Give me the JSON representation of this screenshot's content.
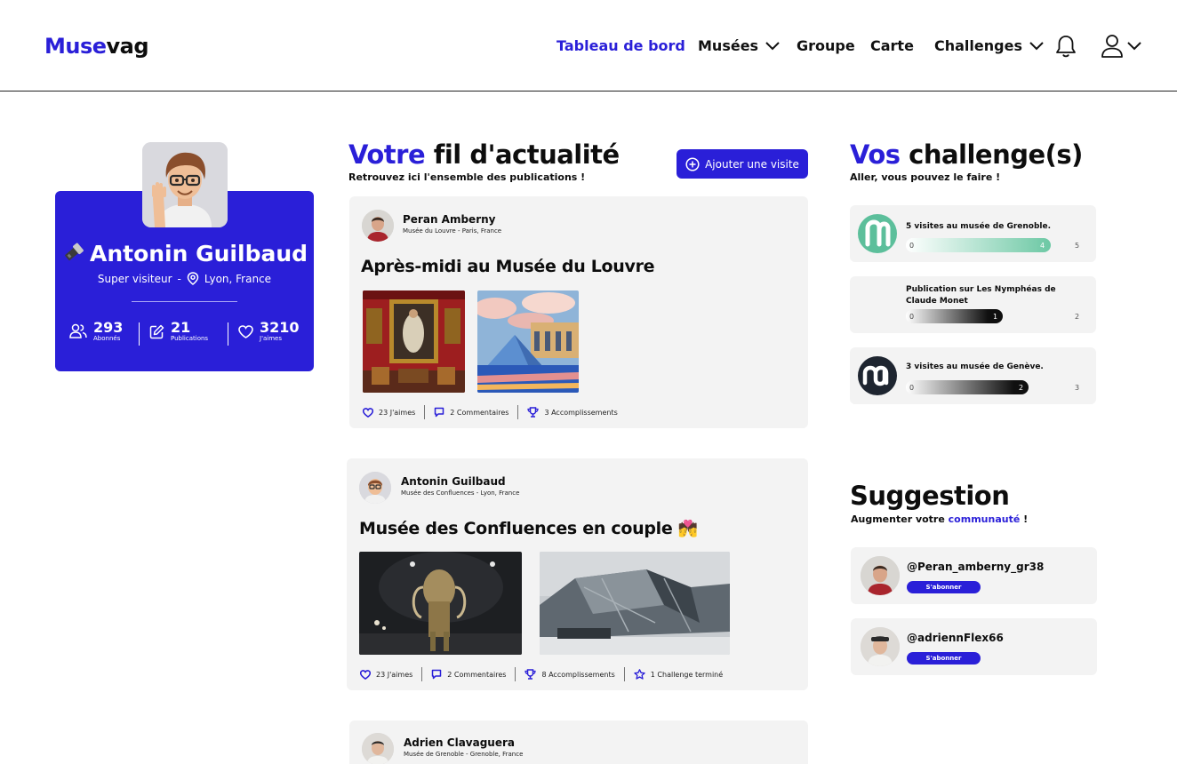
{
  "header": {
    "logo_part1": "Muse",
    "logo_part2": "vag",
    "nav": {
      "dashboard": "Tableau de bord",
      "museums": "Musées",
      "group": "Groupe",
      "map": "Carte",
      "challenges": "Challenges"
    }
  },
  "profile": {
    "name": "Antonin Guilbaud",
    "rank": "Super visiteur",
    "separator": "-",
    "location": "Lyon, France",
    "stats": [
      {
        "value": "293",
        "label": "Abonnés",
        "icon": "users-icon"
      },
      {
        "value": "21",
        "label": "Publications",
        "icon": "edit-icon"
      },
      {
        "value": "3210",
        "label": "J'aimes",
        "icon": "heart-icon"
      }
    ]
  },
  "feed": {
    "title_hl": "Votre",
    "title_rest": " fil d'actualité",
    "subtitle": "Retrouvez ici l'ensemble des publications !",
    "add_button": "Ajouter une visite",
    "posts": [
      {
        "author": "Peran Amberny",
        "place": "Musée du Louvre - Paris, France",
        "title": "Après-midi au Musée du Louvre",
        "likes": "23 J'aimes",
        "comments": "2 Commentaires",
        "achievements": "3 Accomplissements"
      },
      {
        "author": "Antonin Guilbaud",
        "place": "Musée des Confluences - Lyon, France",
        "title": "Musée des Confluences en couple",
        "emoji": "💏",
        "likes": "23 J'aimes",
        "comments": "2 Commentaires",
        "achievements": "8 Accomplissements",
        "challenge": "1 Challenge terminé"
      },
      {
        "author": "Adrien Clavaguera",
        "place": "Musée de Grenoble - Grenoble, France"
      }
    ]
  },
  "challenges": {
    "title_hl": "Vos",
    "title_rest": " challenge(s)",
    "subtitle": "Aller, vous pouvez le faire !",
    "items": [
      {
        "title": "5 visites au musée de Grenoble.",
        "min": "0",
        "current": "4",
        "max": "5",
        "progress": 0.8,
        "color": "#4fb896"
      },
      {
        "title": "Publication sur Les Nymphéas de Claude Monet",
        "min": "0",
        "current": "1",
        "max": "2",
        "progress": 0.5,
        "color": "#111111"
      },
      {
        "title": "3 visites au musée de Genève.",
        "min": "0",
        "current": "2",
        "max": "3",
        "progress": 0.667,
        "color": "#111111"
      }
    ]
  },
  "suggestion": {
    "title": "Suggestion",
    "subtitle_pre": "Augmenter votre ",
    "subtitle_hl": "communauté",
    "subtitle_post": " !",
    "items": [
      {
        "handle": "@Peran_amberny_gr38",
        "button": "S'abonner"
      },
      {
        "handle": "@adriennFlex66",
        "button": "S'abonner"
      }
    ]
  },
  "colors": {
    "accent": "#2a1fd8",
    "card": "#f3f3f3",
    "grenoble_icon": "#5cbf9b"
  }
}
